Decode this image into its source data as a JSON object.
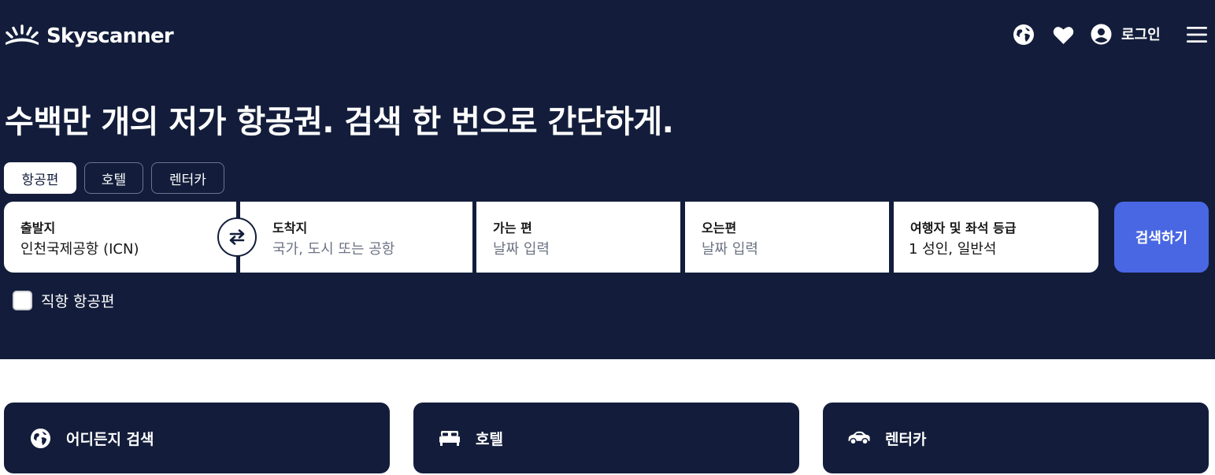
{
  "header": {
    "brand": "Skyscanner",
    "login_label": "로그인",
    "icons": [
      "globe-icon",
      "heart-icon",
      "account-icon",
      "menu-icon"
    ]
  },
  "hero": {
    "headline": "수백만 개의 저가 항공권. 검색 한 번으로 간단하게."
  },
  "tabs": [
    {
      "label": "항공편",
      "active": true
    },
    {
      "label": "호텔",
      "active": false
    },
    {
      "label": "렌터카",
      "active": false
    }
  ],
  "search": {
    "origin": {
      "label": "출발지",
      "value": "인천국제공항 (ICN)"
    },
    "destination": {
      "label": "도착지",
      "placeholder": "국가, 도시 또는 공항"
    },
    "depart": {
      "label": "가는 편",
      "placeholder": "날짜 입력"
    },
    "return": {
      "label": "오는편",
      "placeholder": "날짜 입력"
    },
    "travellers": {
      "label": "여행자 및 좌석 등급",
      "value": "1 성인, 일반석"
    },
    "button_label": "검색하기"
  },
  "direct_flights": {
    "label": "직항 항공편",
    "checked": false
  },
  "cards": [
    {
      "label": "어디든지 검색",
      "icon": "globe-icon"
    },
    {
      "label": "호텔",
      "icon": "bed-icon"
    },
    {
      "label": "렌터카",
      "icon": "car-icon"
    }
  ],
  "colors": {
    "background_dark": "#131d3b",
    "accent_button": "#4967e3",
    "white": "#ffffff"
  }
}
